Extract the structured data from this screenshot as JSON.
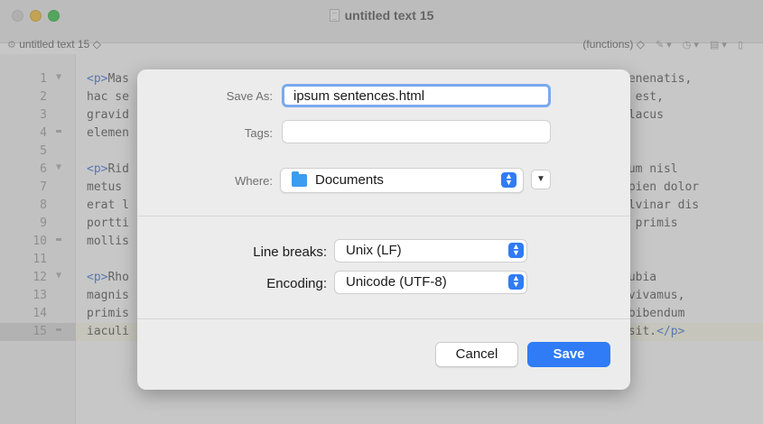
{
  "window": {
    "title": "untitled text 15",
    "nav_file": "untitled text 15 ◇",
    "nav_functions": "(functions) ◇"
  },
  "editor": {
    "lines": [
      {
        "num": "1",
        "fold": "▼",
        "left": "<p>Mas",
        "right": "venenatis,"
      },
      {
        "num": "2",
        "fold": "",
        "left": "hac se",
        "right": "s est,"
      },
      {
        "num": "3",
        "fold": "",
        "left": "gravid",
        "right": " lacus"
      },
      {
        "num": "4",
        "fold": "▬",
        "left": "elemen",
        "right": ""
      },
      {
        "num": "5",
        "fold": "",
        "left": "",
        "right": ""
      },
      {
        "num": "6",
        "fold": "▼",
        "left": "<p>Rid",
        "right": "lum nisl"
      },
      {
        "num": "7",
        "fold": "",
        "left": "metus ",
        "right": "apien dolor"
      },
      {
        "num": "8",
        "fold": "",
        "left": "erat l",
        "right": "ulvinar dis"
      },
      {
        "num": "9",
        "fold": "",
        "left": "portti",
        "right": "r primis"
      },
      {
        "num": "10",
        "fold": "▬",
        "left": "mollis",
        "right": ""
      },
      {
        "num": "11",
        "fold": "",
        "left": "",
        "right": ""
      },
      {
        "num": "12",
        "fold": "▼",
        "left": "<p>Rho",
        "right": "nubia"
      },
      {
        "num": "13",
        "fold": "",
        "left": "magnis",
        "right": " vivamus,"
      },
      {
        "num": "14",
        "fold": "",
        "left": "primis",
        "right": " bibendum"
      },
      {
        "num": "15",
        "fold": "▬",
        "left": "iaculi",
        "right": " sit.</p>"
      }
    ]
  },
  "dialog": {
    "save_as_label": "Save As:",
    "save_as_value": "ipsum sentences.html",
    "tags_label": "Tags:",
    "tags_value": "",
    "where_label": "Where:",
    "where_value": "Documents",
    "line_breaks_label": "Line breaks:",
    "line_breaks_value": "Unix (LF)",
    "encoding_label": "Encoding:",
    "encoding_value": "Unicode (UTF-8)",
    "cancel_label": "Cancel",
    "save_label": "Save"
  },
  "colors": {
    "accent": "#2f7cf6",
    "tag_color": "#3b6fd2",
    "focus_ring": "#7aa9ee"
  }
}
